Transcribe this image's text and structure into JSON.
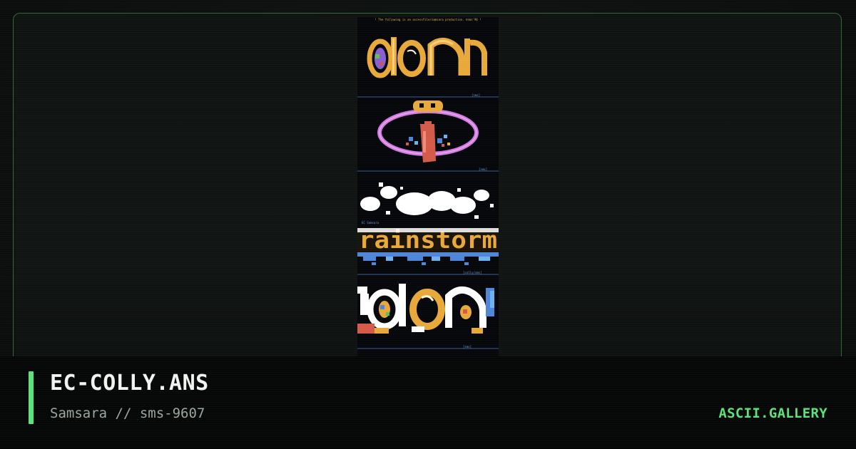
{
  "artwork": {
    "header_line": "! The following is an accessfile/samsara production. ©sms'96 !",
    "divider_tags": [
      "[sms]",
      "[sms]",
      "[colly/sms]",
      "[sms]"
    ],
    "section_label": "EC Samsara",
    "logos": [
      {
        "id": "logo-1",
        "text": "don",
        "colors": [
          "#e8a93a",
          "#8a5fd0",
          "#c65757"
        ]
      },
      {
        "id": "logo-2",
        "text": "",
        "colors": [
          "#d27ae0",
          "#e8a93a",
          "#d45a4a",
          "#4f86d8"
        ]
      },
      {
        "id": "logo-3",
        "text": "rainstorm",
        "colors": [
          "#ffffff",
          "#e8a93a",
          "#4f86d8"
        ]
      },
      {
        "id": "logo-4",
        "text": "don",
        "colors": [
          "#ffffff",
          "#e8a93a",
          "#4f86d8",
          "#d45a4a"
        ]
      }
    ]
  },
  "info": {
    "title": "EC-COLLY.ANS",
    "subtitle": "Samsara // sms-9607",
    "brand": "ASCII.GALLERY"
  },
  "colors": {
    "accent": "#5ce27a",
    "frame_border": "#2f6a33",
    "background": "#0c0f0e"
  }
}
